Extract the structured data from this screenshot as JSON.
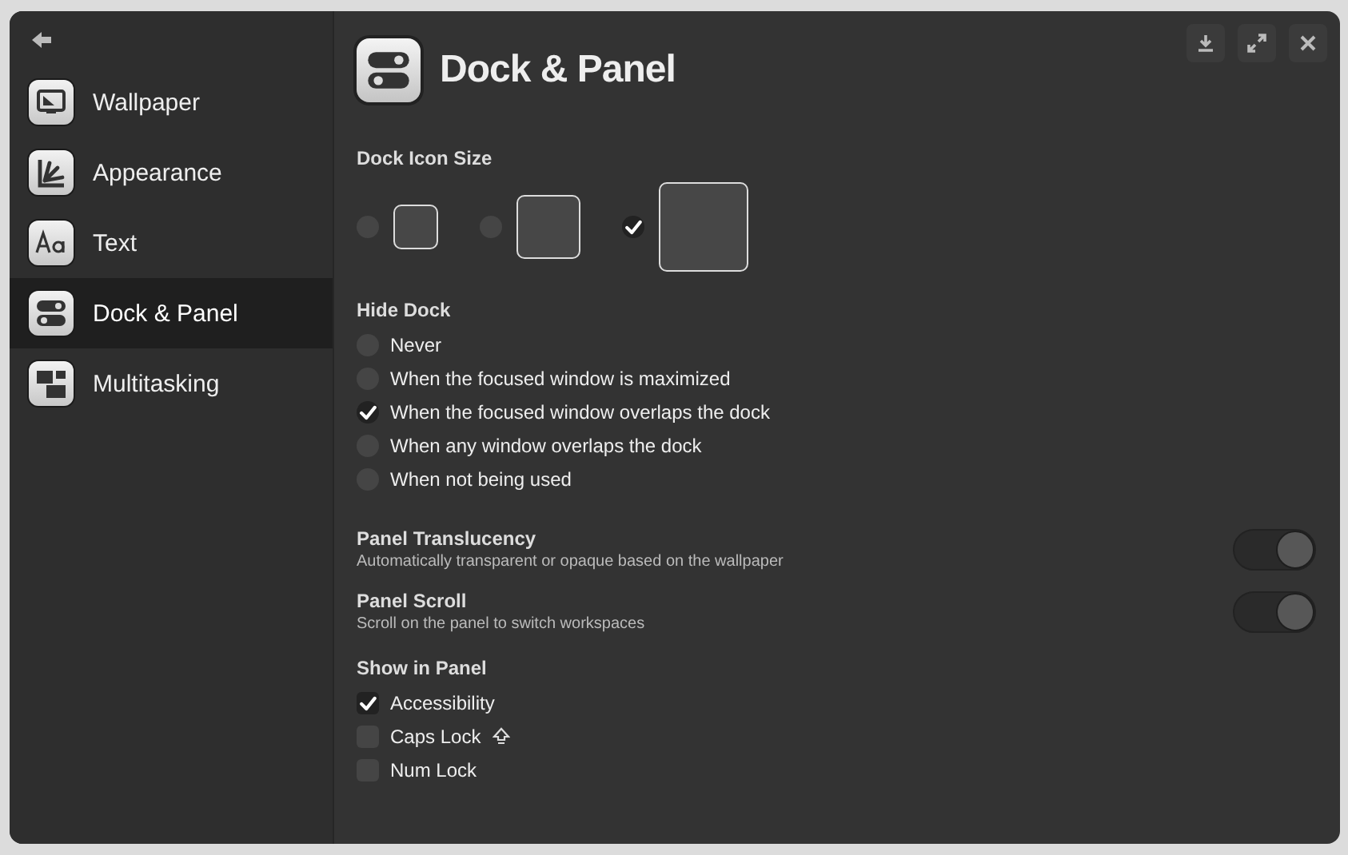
{
  "sidebar": {
    "items": [
      {
        "label": "Wallpaper",
        "selected": false
      },
      {
        "label": "Appearance",
        "selected": false
      },
      {
        "label": "Text",
        "selected": false
      },
      {
        "label": "Dock & Panel",
        "selected": true
      },
      {
        "label": "Multitasking",
        "selected": false
      }
    ]
  },
  "header": {
    "title": "Dock & Panel"
  },
  "dock_icon_size": {
    "title": "Dock Icon Size",
    "options": [
      {
        "selected": false
      },
      {
        "selected": false
      },
      {
        "selected": true
      }
    ]
  },
  "hide_dock": {
    "title": "Hide Dock",
    "options": [
      {
        "label": "Never",
        "selected": false
      },
      {
        "label": "When the focused window is maximized",
        "selected": false
      },
      {
        "label": "When the focused window overlaps the dock",
        "selected": true
      },
      {
        "label": "When any window overlaps the dock",
        "selected": false
      },
      {
        "label": "When not being used",
        "selected": false
      }
    ]
  },
  "switches": [
    {
      "title": "Panel Translucency",
      "description": "Automatically transparent or opaque based on the wallpaper",
      "on": true
    },
    {
      "title": "Panel Scroll",
      "description": "Scroll on the panel to switch workspaces",
      "on": true
    }
  ],
  "show_in_panel": {
    "title": "Show in Panel",
    "items": [
      {
        "label": "Accessibility",
        "checked": true,
        "kind": "plain"
      },
      {
        "label": "Caps Lock",
        "checked": false,
        "kind": "with-icon"
      },
      {
        "label": "Num Lock",
        "checked": false,
        "kind": "plain"
      }
    ]
  }
}
